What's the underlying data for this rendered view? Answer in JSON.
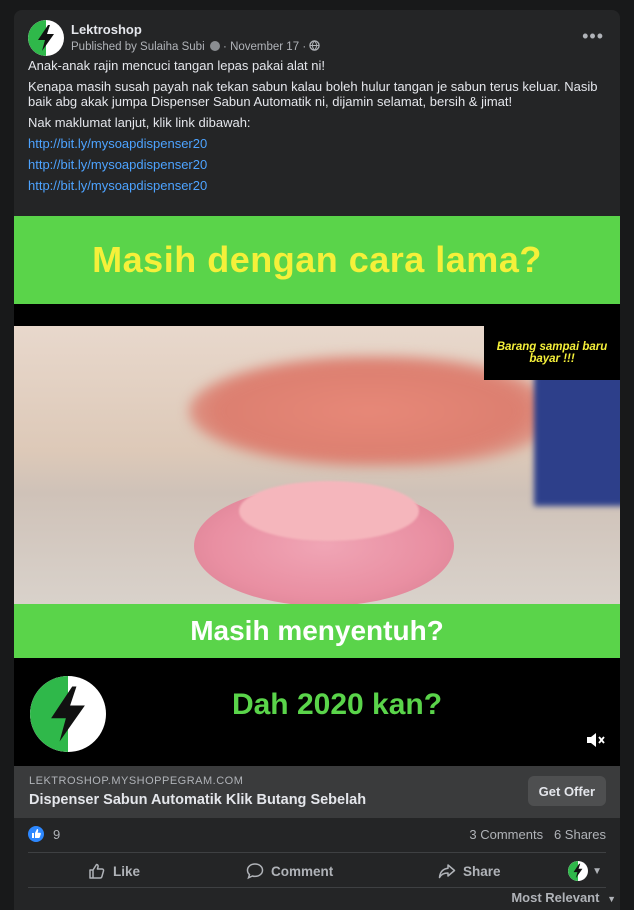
{
  "post": {
    "page_name": "Lektroshop",
    "published_by": "Published by Sulaiha Subi",
    "date": "November 17",
    "text": {
      "line1": "Anak-anak rajin mencuci tangan lepas pakai alat ni!",
      "line2": "Kenapa masih susah payah nak tekan sabun kalau boleh hulur tangan je sabun terus keluar. Nasib baik abg akak jumpa Dispenser Sabun Automatik ni, dijamin selamat, bersih & jimat!",
      "line3": "Nak maklumat lanjut, klik link dibawah:",
      "links": [
        "http://bit.ly/mysoapdispenser20",
        "http://bit.ly/mysoapdispenser20",
        "http://bit.ly/mysoapdispenser20"
      ]
    }
  },
  "media": {
    "headline_top": "Masih dengan cara lama?",
    "tag": "Barang sampai baru bayar !!!",
    "headline_mid": "Masih menyentuh?",
    "headline_bottom": "Dah 2020 kan?"
  },
  "link_preview": {
    "domain": "LEKTROSHOP.MYSHOPPEGRAM.COM",
    "title": "Dispenser Sabun Automatik Klik Butang Sebelah",
    "cta": "Get Offer"
  },
  "engagement": {
    "likes": "9",
    "comments": "3 Comments",
    "shares": "6 Shares"
  },
  "actions": {
    "like": "Like",
    "comment": "Comment",
    "share": "Share"
  },
  "sort": "Most Relevant",
  "colors": {
    "brand_green": "#5ad44a",
    "yellow_text": "#f5f03a",
    "link_blue": "#4da3ff"
  }
}
